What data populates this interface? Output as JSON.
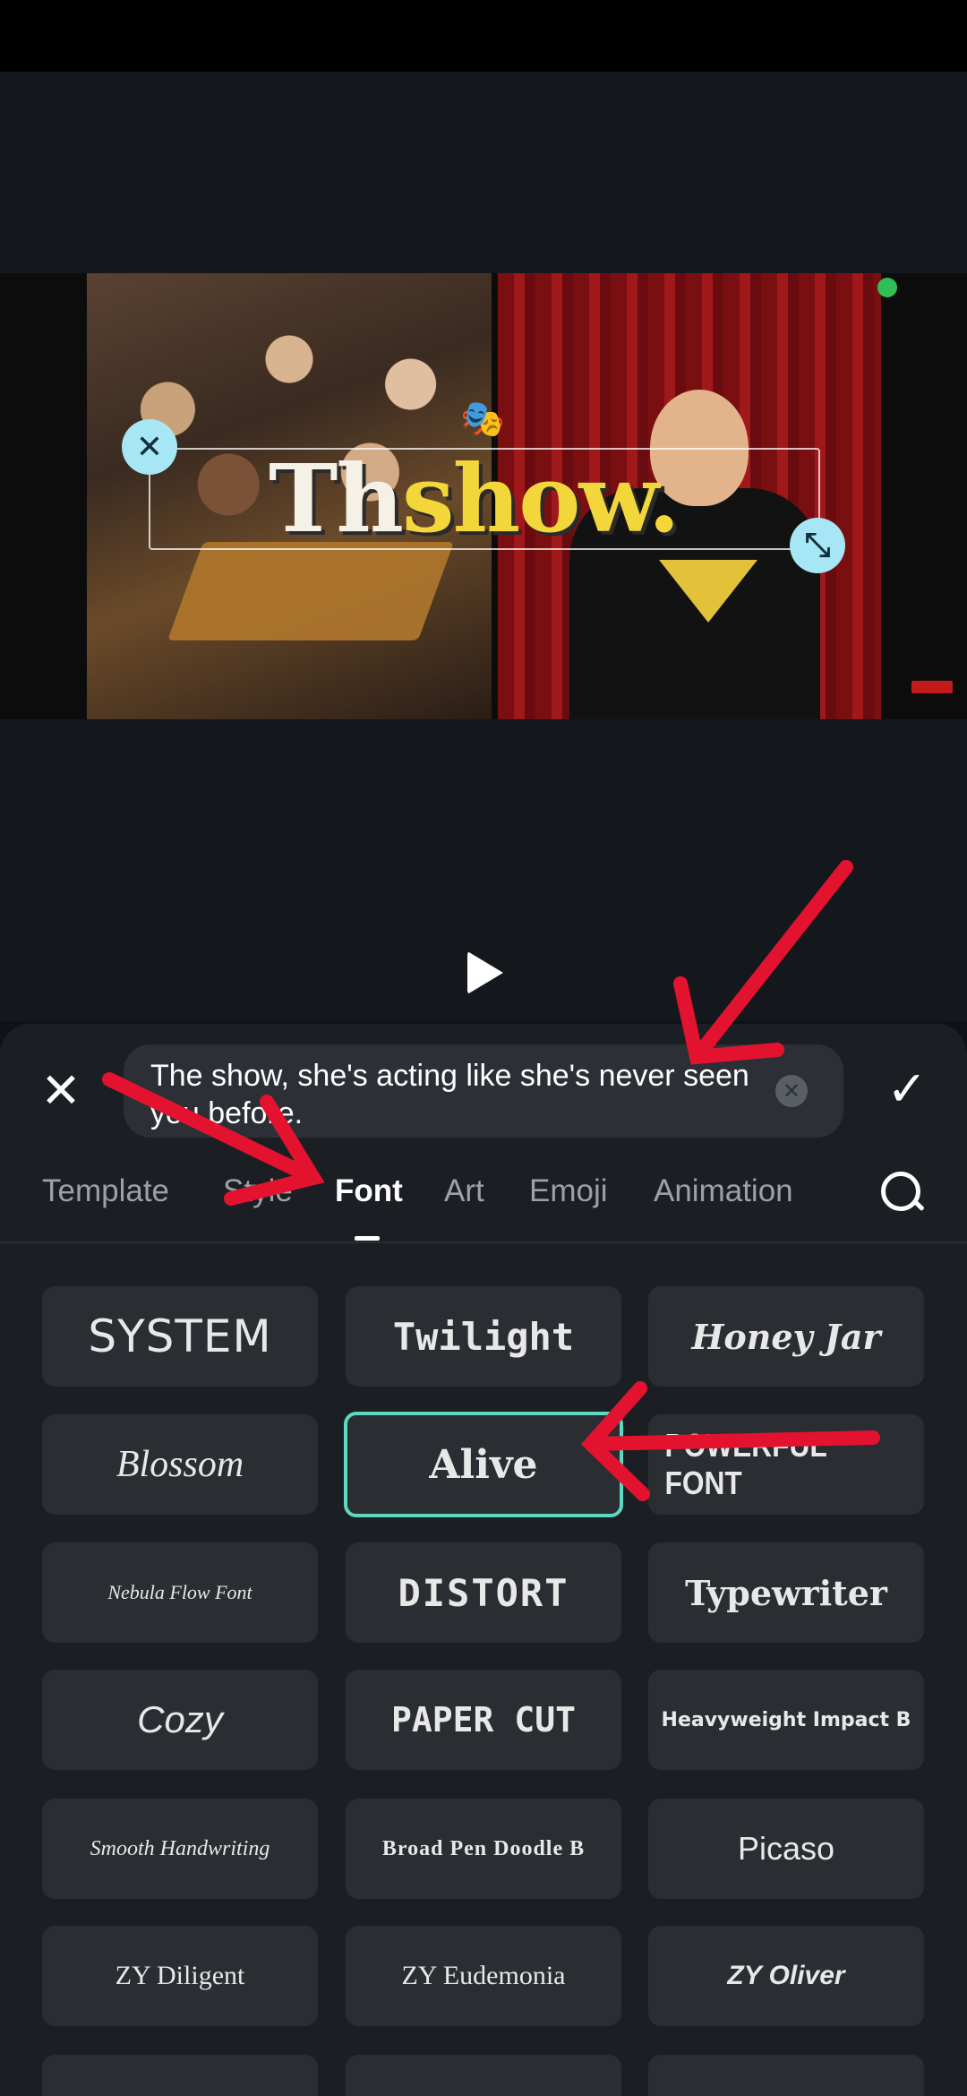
{
  "video": {
    "caption_prefix": "Th",
    "caption_rest": "show.",
    "masks_emoji": "🎭"
  },
  "editor": {
    "close_icon": "close-icon",
    "confirm_icon": "check-icon",
    "text_value": "The show, she's acting like she's never seen you before.",
    "clear_icon": "clear-icon"
  },
  "tabs": [
    {
      "label": "Template"
    },
    {
      "label": "Style"
    },
    {
      "label": "Font"
    },
    {
      "label": "Art"
    },
    {
      "label": "Emoji"
    },
    {
      "label": "Animation"
    }
  ],
  "active_tab": "Font",
  "fonts": [
    {
      "label": "SYSTEM"
    },
    {
      "label": "Twilight"
    },
    {
      "label": "Honey Jar"
    },
    {
      "label": "Blossom"
    },
    {
      "label": "Alive"
    },
    {
      "label": "POWERFUL FONT"
    },
    {
      "label": "Nebula Flow Font"
    },
    {
      "label": "DISTORT"
    },
    {
      "label": "Typewriter"
    },
    {
      "label": "Cozy"
    },
    {
      "label": "PAPER CUT"
    },
    {
      "label": "Heavyweight Impact B"
    },
    {
      "label": "Smooth Handwriting"
    },
    {
      "label": "Broad Pen Doodle B"
    },
    {
      "label": "Picaso"
    },
    {
      "label": "ZY Diligent"
    },
    {
      "label": "ZY Eudemonia"
    },
    {
      "label": "ZY Oliver"
    }
  ],
  "selected_font": "Alive",
  "colors": {
    "accent": "#5fd8c2",
    "annotation_arrow": "#e3132f",
    "handle": "#a7e6f5",
    "caption_yellow": "#f2d63a"
  }
}
